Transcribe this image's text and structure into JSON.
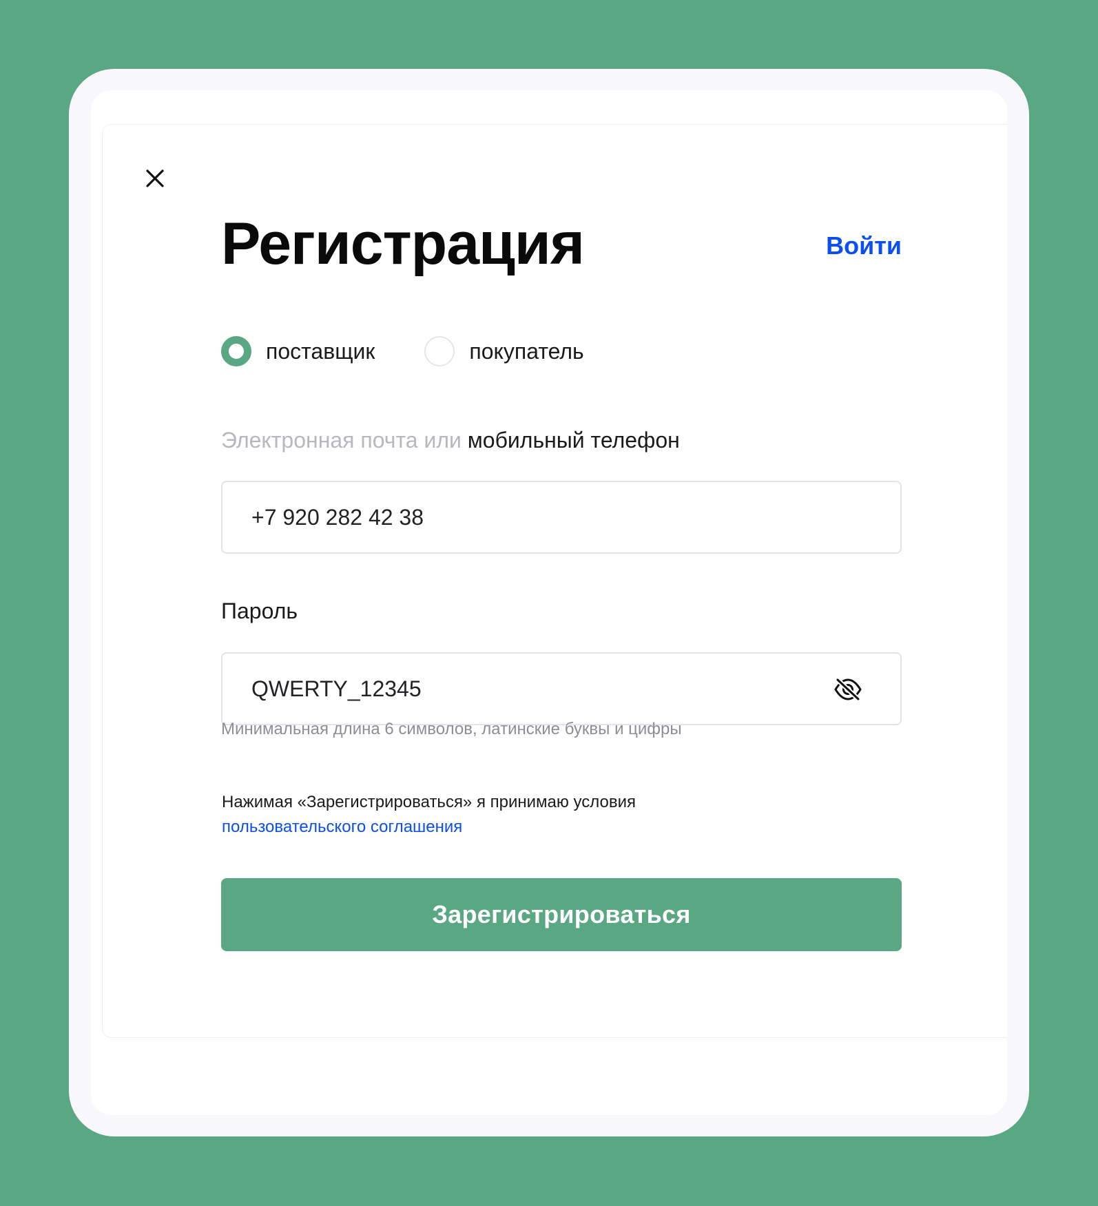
{
  "colors": {
    "background": "#5aa784",
    "accent": "#5aa784",
    "link": "#0b4ff0",
    "text": "#1a1a1a",
    "muted": "#b7b8bd"
  },
  "modal": {
    "close_icon": "close-icon",
    "title": "Регистрация",
    "login_link": "Войти",
    "roles": [
      {
        "label": "поставщик",
        "checked": true
      },
      {
        "label": "покупатель",
        "checked": false
      }
    ],
    "contact_field": {
      "label_muted": "Электронная почта или ",
      "label_active": "мобильный телефон",
      "value": "+7 920 282 42 38"
    },
    "password_field": {
      "label": "Пароль",
      "value": "QWERTY_12345",
      "visibility_icon": "eye-off-icon",
      "hint": "Минимальная длина 6 символов, латинские буквы и цифры"
    },
    "terms": {
      "text": "Нажимая «Зарегистрироваться» я принимаю условия",
      "link": "пользовательского соглашения"
    },
    "submit_label": "Зарегистрироваться"
  }
}
